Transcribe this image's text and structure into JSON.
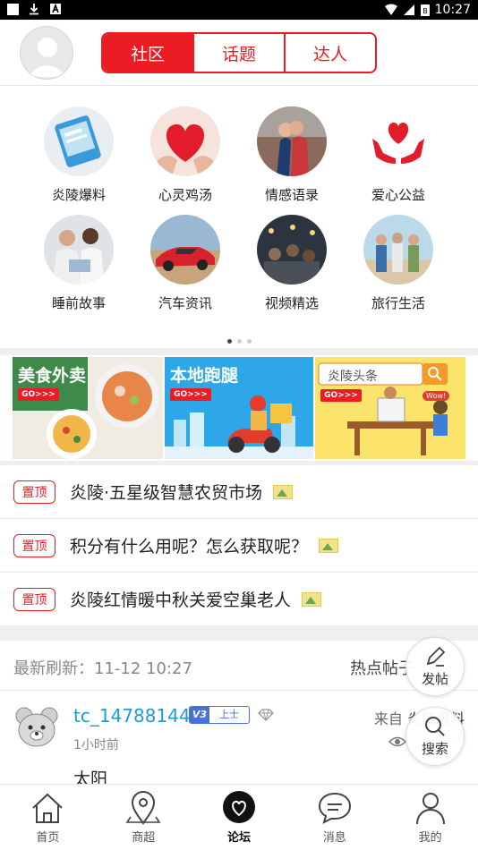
{
  "statusbar": {
    "time": "10:27",
    "battery_icon_text": "B"
  },
  "header": {
    "tabs": [
      {
        "label": "社区",
        "active": true
      },
      {
        "label": "话题",
        "active": false
      },
      {
        "label": "达人",
        "active": false
      }
    ]
  },
  "categories": [
    {
      "label": "炎陵爆料",
      "icon": "news-phone-icon"
    },
    {
      "label": "心灵鸡汤",
      "icon": "heart-hands-icon"
    },
    {
      "label": "情感语录",
      "icon": "couple-icon"
    },
    {
      "label": "爱心公益",
      "icon": "charity-heart-icon"
    },
    {
      "label": "睡前故事",
      "icon": "family-reading-icon"
    },
    {
      "label": "汽车资讯",
      "icon": "sports-car-icon"
    },
    {
      "label": "视频精选",
      "icon": "video-crowd-icon"
    },
    {
      "label": "旅行生活",
      "icon": "travel-group-icon"
    }
  ],
  "pager": {
    "pages": 3,
    "current": 1
  },
  "banners": [
    {
      "title": "美食外卖",
      "go": "GO>>>"
    },
    {
      "title": "本地跑腿",
      "go": "GO>>>"
    },
    {
      "title": "炎陵头条",
      "go": "GO>>>",
      "bubble": "Wow!"
    }
  ],
  "pinned": [
    {
      "badge": "置顶",
      "text": "炎陵·五星级智慧农贸市场"
    },
    {
      "badge": "置顶",
      "text": "积分有什么用呢？怎么获取呢？"
    },
    {
      "badge": "置顶",
      "text": "炎陵红情暖中秋关爱空巢老人"
    }
  ],
  "refresh": {
    "label": "最新刷新：11-12 10:27",
    "hot": "热点帖子"
  },
  "post": {
    "username": "tc_14788144",
    "level_badge": "V3",
    "level_title": "上士",
    "time": "1小时前",
    "from_prefix": "来自",
    "from_source": "炎陵爆料",
    "views": "0",
    "title": "太阳"
  },
  "fab": {
    "post_label": "发帖",
    "search_label": "搜索"
  },
  "bottomnav": [
    {
      "label": "首页",
      "active": false
    },
    {
      "label": "商超",
      "active": false
    },
    {
      "label": "论坛",
      "active": true
    },
    {
      "label": "消息",
      "active": false
    },
    {
      "label": "我的",
      "active": false
    }
  ],
  "colors": {
    "accent": "#ec1c24",
    "link": "#1e9bd7",
    "level": "#4a6fd8"
  }
}
